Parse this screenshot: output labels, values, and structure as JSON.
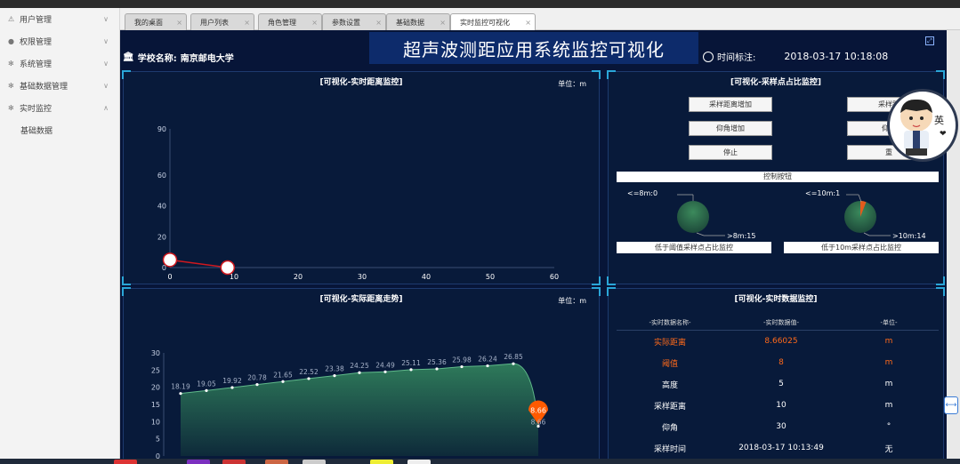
{
  "sidebar": {
    "items": [
      {
        "label": "用户管理",
        "icon": "user-icon"
      },
      {
        "label": "权限管理",
        "icon": "person-icon"
      },
      {
        "label": "系统管理",
        "icon": "gear-icon"
      },
      {
        "label": "基础数据管理",
        "icon": "gear-icon"
      },
      {
        "label": "实时监控",
        "icon": "gear-icon"
      }
    ],
    "sub_items": [
      "基础数据"
    ]
  },
  "tabs": [
    {
      "label": "我的桌面"
    },
    {
      "label": "用户列表"
    },
    {
      "label": "角色管理"
    },
    {
      "label": "参数设置"
    },
    {
      "label": "基础数据"
    },
    {
      "label": "实时监控可视化"
    }
  ],
  "header": {
    "title": "超声波测距应用系统监控可视化",
    "school_label": "学校名称:",
    "school_name": "南京邮电大学",
    "time_label": "时间标注:",
    "time_value": "2018-03-17 10:18:08"
  },
  "panel1": {
    "title": "[可视化-实时距离监控]",
    "unit": "单位：m"
  },
  "panel2": {
    "title": "[可视化-采样点占比监控]",
    "buttons_left": [
      "采样距离增加",
      "仰角增加",
      "停止"
    ],
    "buttons_right": [
      "采样距",
      "仰角",
      "重"
    ],
    "control_label": "控制按钮",
    "pie1": {
      "label": "低于阈值采样点占比监控",
      "top_label": "<=8m:0",
      "bottom_label": ">8m:15"
    },
    "pie2": {
      "label": "低于10m采样点占比监控",
      "top_label": "<=10m:1",
      "bottom_label": ">10m:14"
    }
  },
  "panel3": {
    "title": "[可视化-实际距离走势]",
    "unit": "单位：m",
    "peak_label": "8.66"
  },
  "panel4": {
    "title": "[可视化-实时数据监控]",
    "columns": [
      "-实时数据名称-",
      "-实时数据值-",
      "-单位-"
    ],
    "rows": [
      {
        "name": "实际距离",
        "value": "8.66025",
        "unit": "m",
        "alert": true
      },
      {
        "name": "阈值",
        "value": "8",
        "unit": "m",
        "alert": true
      },
      {
        "name": "高度",
        "value": "5",
        "unit": "m",
        "alert": false
      },
      {
        "name": "采样距离",
        "value": "10",
        "unit": "m",
        "alert": false
      },
      {
        "name": "仰角",
        "value": "30",
        "unit": "°",
        "alert": false
      },
      {
        "name": "采样时间",
        "value": "2018-03-17 10:13:49",
        "unit": "无",
        "alert": false
      }
    ]
  },
  "avatar_text": "英",
  "chart_data": [
    {
      "type": "line",
      "title": "[可视化-实时距离监控]",
      "xlim": [
        0,
        60
      ],
      "ylim": [
        0,
        90
      ],
      "x_ticks": [
        0,
        10,
        20,
        30,
        40,
        50,
        60
      ],
      "y_ticks": [
        0,
        20,
        40,
        60,
        90
      ],
      "series": [
        {
          "x": [
            0,
            9
          ],
          "y": [
            5,
            0
          ]
        }
      ]
    },
    {
      "type": "area",
      "title": "[可视化-实际距离走势]",
      "ylim": [
        0,
        30
      ],
      "y_ticks": [
        0,
        5,
        10,
        15,
        20,
        25,
        30
      ],
      "series": [
        {
          "values": [
            18.19,
            19.05,
            19.92,
            20.78,
            21.65,
            22.52,
            23.38,
            24.25,
            24.49,
            25.11,
            25.36,
            25.98,
            26.24,
            26.85,
            8.66
          ]
        }
      ]
    }
  ]
}
